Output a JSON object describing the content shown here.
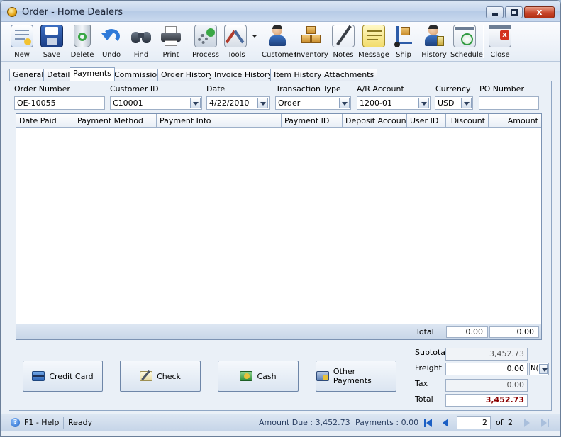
{
  "window": {
    "title": "Order - Home Dealers",
    "close_glyph": "x"
  },
  "toolbar": {
    "buttons": [
      {
        "label": "New",
        "icon": "new-document-icon"
      },
      {
        "label": "Save",
        "icon": "floppy-disk-icon"
      },
      {
        "label": "Delete",
        "icon": "recycle-bin-icon"
      },
      {
        "label": "Undo",
        "icon": "undo-arrow-icon"
      },
      {
        "label": "Find",
        "icon": "binoculars-icon"
      },
      {
        "label": "Print",
        "icon": "printer-icon"
      },
      {
        "label": "Process",
        "icon": "gears-icon"
      },
      {
        "label": "Tools",
        "icon": "tools-icon"
      },
      {
        "label": "Customer",
        "icon": "customer-person-icon"
      },
      {
        "label": "Inventory",
        "icon": "boxes-icon"
      },
      {
        "label": "Notes",
        "icon": "notepad-pen-icon"
      },
      {
        "label": "Message",
        "icon": "message-note-icon"
      },
      {
        "label": "Ship",
        "icon": "hand-truck-icon"
      },
      {
        "label": "History",
        "icon": "history-person-icon"
      },
      {
        "label": "Schedule",
        "icon": "calendar-clock-icon"
      },
      {
        "label": "Close",
        "icon": "close-window-icon"
      }
    ]
  },
  "tabs": [
    "General",
    "Detail",
    "Payments",
    "Commission",
    "Order History",
    "Invoice History",
    "Item History",
    "Attachments"
  ],
  "active_tab": "Payments",
  "form": {
    "order_number": {
      "label": "Order Number",
      "value": "OE-10055"
    },
    "customer_id": {
      "label": "Customer ID",
      "value": "C10001"
    },
    "date": {
      "label": "Date",
      "value": "4/22/2010"
    },
    "transaction_type": {
      "label": "Transaction Type",
      "value": "Order"
    },
    "ar_account": {
      "label": "A/R Account",
      "value": "1200-01"
    },
    "currency": {
      "label": "Currency",
      "value": "USD"
    },
    "po_number": {
      "label": "PO Number",
      "value": ""
    }
  },
  "grid": {
    "columns": [
      "Date Paid",
      "Payment Method",
      "Payment Info",
      "Payment ID",
      "Deposit Account",
      "User ID",
      "Discount",
      "Amount"
    ],
    "rows": [],
    "footer": {
      "label": "Total",
      "discount_total": "0.00",
      "amount_total": "0.00"
    }
  },
  "payment_buttons": [
    {
      "label": "Credit Card",
      "icon": "credit-card-icon"
    },
    {
      "label": "Check",
      "icon": "check-pen-icon"
    },
    {
      "label": "Cash",
      "icon": "cash-money-icon"
    },
    {
      "label": "Other Payments",
      "icon": "other-payments-icon"
    }
  ],
  "totals": {
    "subtotal": {
      "label": "Subtotal",
      "value": "3,452.73"
    },
    "freight": {
      "label": "Freight",
      "value": "0.00",
      "tax_code": "N("
    },
    "tax": {
      "label": "Tax",
      "value": "0.00"
    },
    "total": {
      "label": "Total",
      "value": "3,452.73",
      "color": "#8b0000"
    }
  },
  "statusbar": {
    "help": "F1 - Help",
    "status": "Ready",
    "amount_due": "Amount Due : 3,452.73",
    "payments": "Payments : 0.00",
    "page": "2",
    "of_label": "of",
    "total_pages": "2"
  },
  "colors": {
    "accent": "#1b5fc4",
    "total_value": "#8b0000"
  }
}
